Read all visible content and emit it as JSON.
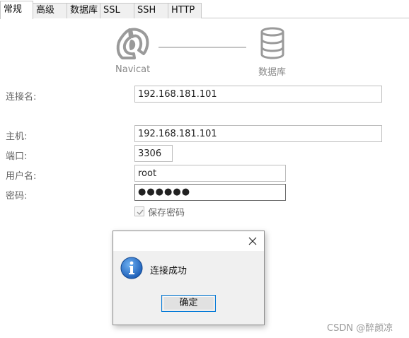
{
  "tabs": [
    {
      "label": "常规",
      "active": true
    },
    {
      "label": "高级",
      "active": false
    },
    {
      "label": "数据库",
      "active": false
    },
    {
      "label": "SSL",
      "active": false
    },
    {
      "label": "SSH",
      "active": false
    },
    {
      "label": "HTTP",
      "active": false
    }
  ],
  "diagram": {
    "left_label": "Navicat",
    "right_label": "数据库",
    "left_icon": "navicat-logo-icon",
    "right_icon": "database-icon"
  },
  "form": {
    "connection_name_label": "连接名:",
    "connection_name_value": "192.168.181.101",
    "host_label": "主机:",
    "host_value": "192.168.181.101",
    "port_label": "端口:",
    "port_value": "3306",
    "username_label": "用户名:",
    "username_value": "root",
    "password_label": "密码:",
    "password_masked": "●●●●●●",
    "save_password_label": "保存密码",
    "save_password_checked": true
  },
  "dialog": {
    "message": "连接成功",
    "ok_label": "确定",
    "icon": "info-icon",
    "close_icon": "close-icon"
  },
  "watermark": "CSDN @醉颜凉",
  "colors": {
    "button_focus_border": "#0078d7",
    "info_icon_blue": "#1d5fb8"
  }
}
